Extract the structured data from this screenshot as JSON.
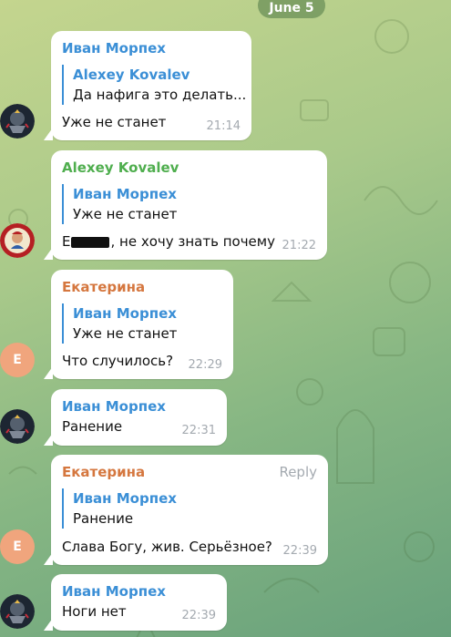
{
  "date_label": "June 5",
  "avatar_letter": "E",
  "reply_label": "Reply",
  "messages": [
    {
      "sender": "Иван Морпех",
      "reply_name": "Alexey Kovalev",
      "reply_text": "Да нафига это делать...",
      "text": "Уже не станет",
      "time": "21:14"
    },
    {
      "sender": "Alexey Kovalev",
      "reply_name": "Иван Морпех",
      "reply_text": "Уже не станет",
      "text_prefix": "Е",
      "text_suffix": ", не хочу знать почему",
      "time": "21:22"
    },
    {
      "sender": "Екатерина",
      "reply_name": "Иван Морпех",
      "reply_text": "Уже не станет",
      "text": "Что случилось?",
      "time": "22:29"
    },
    {
      "sender": "Иван Морпех",
      "text": "Ранение",
      "time": "22:31"
    },
    {
      "sender": "Екатерина",
      "reply_name": "Иван Морпех",
      "reply_text": "Ранение",
      "text": "Слава Богу, жив. Серьёзное?",
      "time": "22:39"
    },
    {
      "sender": "Иван Морпех",
      "text": "Ноги нет",
      "time": "22:39"
    }
  ],
  "colors": {
    "ivan": "#3b8fd6",
    "alexey": "#4fae4e",
    "ekaterina": "#d5773f",
    "avatar_e": "#f0a57d"
  }
}
